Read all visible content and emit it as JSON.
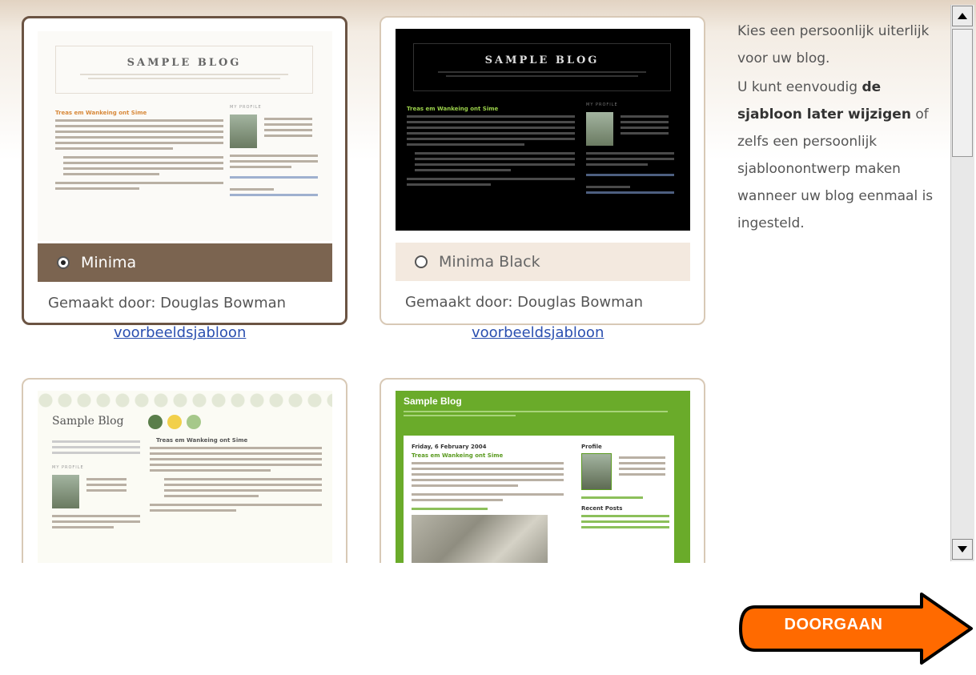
{
  "templates": [
    {
      "name": "Minima",
      "author_label": "Gemaakt door:",
      "author": "Douglas Bowman",
      "link": "voorbeeldsjabloon",
      "selected": true,
      "preview": {
        "title": "SAMPLE BLOG",
        "post_title": "Treas em Wankeing ont Sime",
        "sidebar_heading": "MY PROFILE"
      }
    },
    {
      "name": "Minima Black",
      "author_label": "Gemaakt door:",
      "author": "Douglas Bowman",
      "link": "voorbeeldsjabloon",
      "selected": false,
      "preview": {
        "title": "SAMPLE BLOG",
        "post_title": "Treas em Wankeing ont Sime",
        "sidebar_heading": "MY PROFILE"
      }
    },
    {
      "preview": {
        "title": "Sample Blog",
        "post_title": "Treas em Wankeing ont Sime",
        "sidebar_heading": "MY PROFILE"
      }
    },
    {
      "preview": {
        "title": "Sample Blog",
        "date": "Friday, 6 February 2004",
        "post_title": "Treas em Wankeing ont Sime",
        "sidebar_profile": "Profile",
        "sidebar_recent": "Recent Posts"
      }
    }
  ],
  "info": {
    "p1": "Kies een persoonlijk uiterlijk voor uw blog.",
    "p2_before": "U kunt eenvoudig ",
    "p2_bold": "de sjabloon later wijzigen",
    "p2_after": " of zelfs een persoonlijk sjabloonontwerp maken wanneer uw blog eenmaal is ingesteld."
  },
  "continue_button": "DOORGAAN",
  "colors": {
    "selected_bar": "#7b6450",
    "unselected_bar": "#f3e9df",
    "button_orange": "#ff6a00",
    "link": "#2a4fb0"
  }
}
